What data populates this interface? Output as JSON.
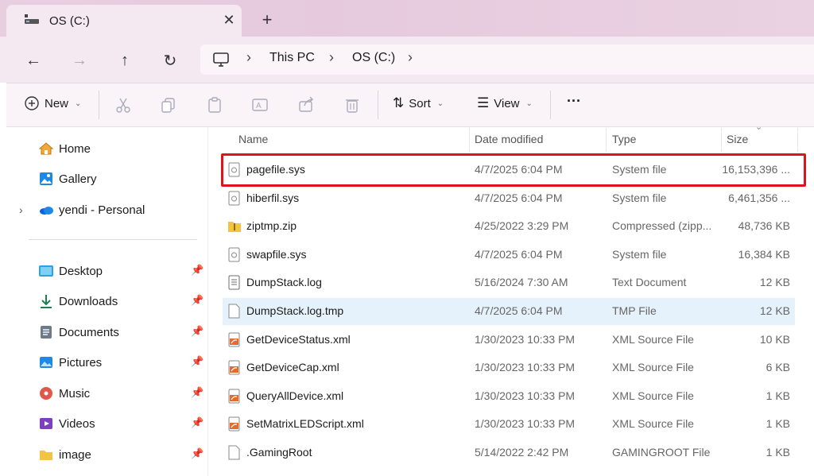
{
  "window": {
    "tab_title": "OS (C:)",
    "close_glyph": "✕",
    "new_tab_glyph": "+"
  },
  "nav": {
    "back": "←",
    "forward": "→",
    "up": "↑",
    "refresh": "↻"
  },
  "breadcrumb": {
    "items": [
      "This PC",
      "OS (C:)"
    ],
    "separator": "›"
  },
  "commands": {
    "new_label": "New",
    "sort_label": "Sort",
    "view_label": "View",
    "more_label": "···"
  },
  "sidebar": {
    "top_items": [
      {
        "label": "Home",
        "icon": "home-icon"
      },
      {
        "label": "Gallery",
        "icon": "gallery-icon"
      },
      {
        "label": "yendi - Personal",
        "icon": "onedrive-icon"
      }
    ],
    "pinned_items": [
      {
        "label": "Desktop",
        "icon": "desktop-icon"
      },
      {
        "label": "Downloads",
        "icon": "download-icon"
      },
      {
        "label": "Documents",
        "icon": "documents-icon"
      },
      {
        "label": "Pictures",
        "icon": "pictures-icon"
      },
      {
        "label": "Music",
        "icon": "music-icon"
      },
      {
        "label": "Videos",
        "icon": "videos-icon"
      },
      {
        "label": "image",
        "icon": "folder-icon"
      }
    ],
    "expander": "›",
    "pin_glyph": "📌"
  },
  "columns": {
    "name": "Name",
    "date": "Date modified",
    "type": "Type",
    "size": "Size"
  },
  "files": [
    {
      "name": "pagefile.sys",
      "date": "4/7/2025 6:04 PM",
      "type": "System file",
      "size": "16,153,396 ...",
      "icon": "system-file-icon"
    },
    {
      "name": "hiberfil.sys",
      "date": "4/7/2025 6:04 PM",
      "type": "System file",
      "size": "6,461,356 ...",
      "icon": "system-file-icon"
    },
    {
      "name": "ziptmp.zip",
      "date": "4/25/2022 3:29 PM",
      "type": "Compressed (zipp...",
      "size": "48,736 KB",
      "icon": "zip-folder-icon"
    },
    {
      "name": "swapfile.sys",
      "date": "4/7/2025 6:04 PM",
      "type": "System file",
      "size": "16,384 KB",
      "icon": "system-file-icon"
    },
    {
      "name": "DumpStack.log",
      "date": "5/16/2024 7:30 AM",
      "type": "Text Document",
      "size": "12 KB",
      "icon": "text-file-icon"
    },
    {
      "name": "DumpStack.log.tmp",
      "date": "4/7/2025 6:04 PM",
      "type": "TMP File",
      "size": "12 KB",
      "icon": "blank-file-icon"
    },
    {
      "name": "GetDeviceStatus.xml",
      "date": "1/30/2023 10:33 PM",
      "type": "XML Source File",
      "size": "10 KB",
      "icon": "xml-file-icon"
    },
    {
      "name": "GetDeviceCap.xml",
      "date": "1/30/2023 10:33 PM",
      "type": "XML Source File",
      "size": "6 KB",
      "icon": "xml-file-icon"
    },
    {
      "name": "QueryAllDevice.xml",
      "date": "1/30/2023 10:33 PM",
      "type": "XML Source File",
      "size": "1 KB",
      "icon": "xml-file-icon"
    },
    {
      "name": "SetMatrixLEDScript.xml",
      "date": "1/30/2023 10:33 PM",
      "type": "XML Source File",
      "size": "1 KB",
      "icon": "xml-file-icon"
    },
    {
      "name": ".GamingRoot",
      "date": "5/14/2022 2:42 PM",
      "type": "GAMINGROOT File",
      "size": "1 KB",
      "icon": "blank-file-icon"
    }
  ],
  "colors": {
    "highlight_border": "#e0121b",
    "selected_row": "#e6f2fb",
    "titlebar": "#e8cfe0"
  }
}
